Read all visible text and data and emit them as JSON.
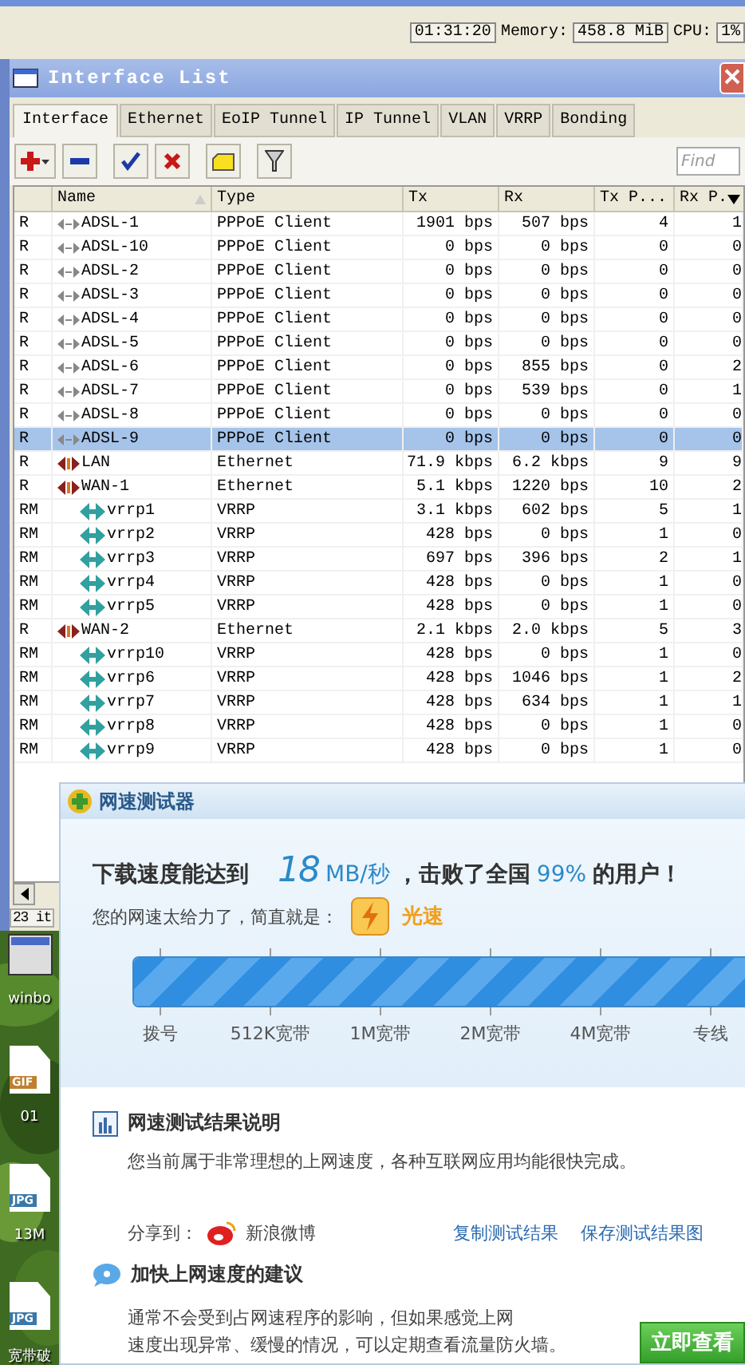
{
  "top_bar": {
    "time": "01:31:20",
    "memory_label": "Memory:",
    "memory": "458.8 MiB",
    "cpu_label": "CPU:",
    "cpu": "1%"
  },
  "window": {
    "title": "Interface List"
  },
  "tabs": [
    {
      "label": "Interface",
      "selected": true
    },
    {
      "label": "Ethernet",
      "selected": false
    },
    {
      "label": "EoIP Tunnel",
      "selected": false
    },
    {
      "label": "IP Tunnel",
      "selected": false
    },
    {
      "label": "VLAN",
      "selected": false
    },
    {
      "label": "VRRP",
      "selected": false
    },
    {
      "label": "Bonding",
      "selected": false
    }
  ],
  "find": {
    "placeholder": "Find"
  },
  "table": {
    "columns": [
      "Name",
      "Type",
      "Tx",
      "Rx",
      "Tx P...",
      "Rx P."
    ],
    "rows": [
      {
        "flags": "R",
        "name": "ADSL-1",
        "kind": "pppoe",
        "type": "PPPoE Client",
        "tx": "1901 bps",
        "rx": "507 bps",
        "tx_packets": "4",
        "rx_packets": "1",
        "selected": false
      },
      {
        "flags": "R",
        "name": "ADSL-10",
        "kind": "pppoe",
        "type": "PPPoE Client",
        "tx": "0 bps",
        "rx": "0 bps",
        "tx_packets": "0",
        "rx_packets": "0",
        "selected": false
      },
      {
        "flags": "R",
        "name": "ADSL-2",
        "kind": "pppoe",
        "type": "PPPoE Client",
        "tx": "0 bps",
        "rx": "0 bps",
        "tx_packets": "0",
        "rx_packets": "0",
        "selected": false
      },
      {
        "flags": "R",
        "name": "ADSL-3",
        "kind": "pppoe",
        "type": "PPPoE Client",
        "tx": "0 bps",
        "rx": "0 bps",
        "tx_packets": "0",
        "rx_packets": "0",
        "selected": false
      },
      {
        "flags": "R",
        "name": "ADSL-4",
        "kind": "pppoe",
        "type": "PPPoE Client",
        "tx": "0 bps",
        "rx": "0 bps",
        "tx_packets": "0",
        "rx_packets": "0",
        "selected": false
      },
      {
        "flags": "R",
        "name": "ADSL-5",
        "kind": "pppoe",
        "type": "PPPoE Client",
        "tx": "0 bps",
        "rx": "0 bps",
        "tx_packets": "0",
        "rx_packets": "0",
        "selected": false
      },
      {
        "flags": "R",
        "name": "ADSL-6",
        "kind": "pppoe",
        "type": "PPPoE Client",
        "tx": "0 bps",
        "rx": "855 bps",
        "tx_packets": "0",
        "rx_packets": "2",
        "selected": false
      },
      {
        "flags": "R",
        "name": "ADSL-7",
        "kind": "pppoe",
        "type": "PPPoE Client",
        "tx": "0 bps",
        "rx": "539 bps",
        "tx_packets": "0",
        "rx_packets": "1",
        "selected": false
      },
      {
        "flags": "R",
        "name": "ADSL-8",
        "kind": "pppoe",
        "type": "PPPoE Client",
        "tx": "0 bps",
        "rx": "0 bps",
        "tx_packets": "0",
        "rx_packets": "0",
        "selected": false
      },
      {
        "flags": "R",
        "name": "ADSL-9",
        "kind": "pppoe",
        "type": "PPPoE Client",
        "tx": "0 bps",
        "rx": "0 bps",
        "tx_packets": "0",
        "rx_packets": "0",
        "selected": true
      },
      {
        "flags": "R",
        "name": "LAN",
        "kind": "ethernet",
        "type": "Ethernet",
        "tx": "71.9 kbps",
        "rx": "6.2 kbps",
        "tx_packets": "9",
        "rx_packets": "9",
        "selected": false
      },
      {
        "flags": "R",
        "name": "WAN-1",
        "kind": "ethernet",
        "type": "Ethernet",
        "tx": "5.1 kbps",
        "rx": "1220 bps",
        "tx_packets": "10",
        "rx_packets": "2",
        "selected": false,
        "children": [
          {
            "flags": "RM",
            "name": "vrrp1",
            "kind": "vrrp",
            "type": "VRRP",
            "tx": "3.1 kbps",
            "rx": "602 bps",
            "tx_packets": "5",
            "rx_packets": "1",
            "selected": false
          },
          {
            "flags": "RM",
            "name": "vrrp2",
            "kind": "vrrp",
            "type": "VRRP",
            "tx": "428 bps",
            "rx": "0 bps",
            "tx_packets": "1",
            "rx_packets": "0",
            "selected": false
          },
          {
            "flags": "RM",
            "name": "vrrp3",
            "kind": "vrrp",
            "type": "VRRP",
            "tx": "697 bps",
            "rx": "396 bps",
            "tx_packets": "2",
            "rx_packets": "1",
            "selected": false
          },
          {
            "flags": "RM",
            "name": "vrrp4",
            "kind": "vrrp",
            "type": "VRRP",
            "tx": "428 bps",
            "rx": "0 bps",
            "tx_packets": "1",
            "rx_packets": "0",
            "selected": false
          },
          {
            "flags": "RM",
            "name": "vrrp5",
            "kind": "vrrp",
            "type": "VRRP",
            "tx": "428 bps",
            "rx": "0 bps",
            "tx_packets": "1",
            "rx_packets": "0",
            "selected": false
          }
        ]
      },
      {
        "flags": "R",
        "name": "WAN-2",
        "kind": "ethernet",
        "type": "Ethernet",
        "tx": "2.1 kbps",
        "rx": "2.0 kbps",
        "tx_packets": "5",
        "rx_packets": "3",
        "selected": false,
        "children": [
          {
            "flags": "RM",
            "name": "vrrp10",
            "kind": "vrrp",
            "type": "VRRP",
            "tx": "428 bps",
            "rx": "0 bps",
            "tx_packets": "1",
            "rx_packets": "0",
            "selected": false
          },
          {
            "flags": "RM",
            "name": "vrrp6",
            "kind": "vrrp",
            "type": "VRRP",
            "tx": "428 bps",
            "rx": "1046 bps",
            "tx_packets": "1",
            "rx_packets": "2",
            "selected": false
          },
          {
            "flags": "RM",
            "name": "vrrp7",
            "kind": "vrrp",
            "type": "VRRP",
            "tx": "428 bps",
            "rx": "634 bps",
            "tx_packets": "1",
            "rx_packets": "1",
            "selected": false
          },
          {
            "flags": "RM",
            "name": "vrrp8",
            "kind": "vrrp",
            "type": "VRRP",
            "tx": "428 bps",
            "rx": "0 bps",
            "tx_packets": "1",
            "rx_packets": "0",
            "selected": false
          },
          {
            "flags": "RM",
            "name": "vrrp9",
            "kind": "vrrp",
            "type": "VRRP",
            "tx": "428 bps",
            "rx": "0 bps",
            "tx_packets": "1",
            "rx_packets": "0",
            "selected": false
          }
        ]
      }
    ]
  },
  "status_bar": "23 it",
  "desktop": {
    "icons": [
      {
        "kind": "app",
        "label": "winbo"
      },
      {
        "kind": "file",
        "badge": "GIF",
        "label": "01"
      },
      {
        "kind": "file",
        "badge": "JPG",
        "label": "13M"
      },
      {
        "kind": "file",
        "badge": "JPG",
        "label": "宽带破"
      }
    ]
  },
  "speed_test": {
    "title": "网速测试器",
    "headline_prefix": "下载速度能达到",
    "speed": "18",
    "unit": "MB/秒",
    "headline_middle": "，击败了全国",
    "percent": "99%",
    "headline_suffix": "的用户！",
    "verdict_label": "您的网速太给力了，简直就是：",
    "verdict": "光速",
    "level": 1,
    "scale": [
      "拨号",
      "512K宽带",
      "1M宽带",
      "2M宽带",
      "4M宽带",
      "专线"
    ],
    "result_heading": "网速测试结果说明",
    "result_text": "您当前属于非常理想的上网速度，各种互联网应用均能很快完成。",
    "share_label": "分享到：",
    "share_target": "新浪微博",
    "links": [
      "复制测试结果",
      "保存测试结果图"
    ],
    "tips_heading": "加快上网速度的建议",
    "tips_lines": [
      "通常不会受到占网速程序的影响，但如果感觉上网",
      "速度出现异常、缓慢的情况，可以定期查看流量防火墙。"
    ],
    "action_button": "立即查看"
  }
}
